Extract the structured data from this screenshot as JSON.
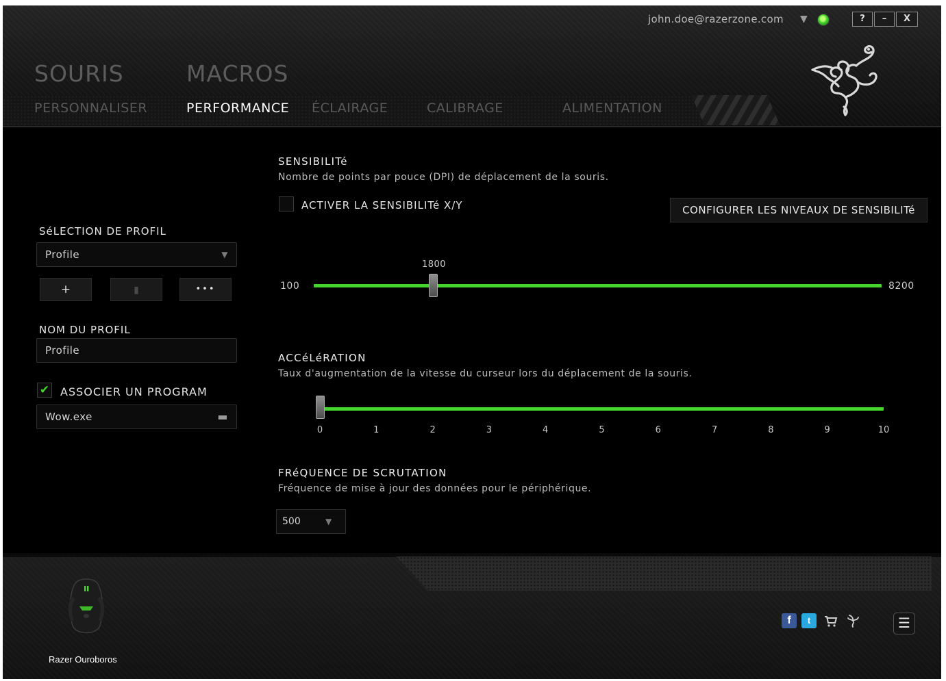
{
  "header": {
    "account_email": "john.doe@razerzone.com",
    "account_menu_icon": "triangle-down-icon",
    "status_icon": "online-dot-icon",
    "window_buttons": {
      "help": "?",
      "minimize": "–",
      "close": "X"
    },
    "main_tabs": [
      {
        "label": "SOURIS",
        "active": false
      },
      {
        "label": "MACROS",
        "active": false
      }
    ],
    "sub_tabs": [
      {
        "label": "PERSONNALISER",
        "active": false
      },
      {
        "label": "PERFORMANCE",
        "active": true
      },
      {
        "label": "ÉCLAIRAGE",
        "active": false
      },
      {
        "label": "CALIBRAGE",
        "active": false
      },
      {
        "label": "ALIMENTATION",
        "active": false
      }
    ],
    "logo": "razer-snake-logo"
  },
  "profile": {
    "selection_label": "SéLECTION DE PROFIL",
    "selected_profile": "Profile",
    "add_button": "+",
    "delete_icon": "trash-icon",
    "more_button": "•••",
    "name_label": "NOM DU PROFIL",
    "name_value": "Profile",
    "associate_checked": true,
    "associate_label": "ASSOCIER UN PROGRAM",
    "program_value": "Wow.exe",
    "folder_icon": "folder-icon"
  },
  "sensitivity": {
    "title": "SENSIBILITé",
    "description": "Nombre de points par pouce (DPI) de déplacement de la souris.",
    "xy_checked": false,
    "xy_label": "ACTIVER LA SENSIBILITé X/Y",
    "config_button": "CONFIGURER LES NIVEAUX DE SENSIBILITé",
    "min": "100",
    "max": "8200",
    "value": "1800",
    "value_num": 1800,
    "min_num": 100,
    "max_num": 8200
  },
  "acceleration": {
    "title": "ACCéLéRATION",
    "description": "Taux d'augmentation de la vitesse du curseur lors du déplacement de la souris.",
    "value_num": 0,
    "ticks": [
      "0",
      "1",
      "2",
      "3",
      "4",
      "5",
      "6",
      "7",
      "8",
      "9",
      "10"
    ]
  },
  "polling": {
    "title": "FRéQUENCE DE SCRUTATION",
    "description": "Fréquence de mise à jour des données pour le périphérique.",
    "value": "500"
  },
  "footer": {
    "device_name": "Razer Ouroboros",
    "device_image": "mouse-image",
    "social": {
      "facebook": "f",
      "twitter": "t"
    },
    "store_icon": "cart-icon",
    "razer_icon": "razer-icon",
    "menu_icon": "menu-icon"
  },
  "colors": {
    "accent": "#44d62c",
    "background": "#000000",
    "inactive_tab": "#5a5a5a",
    "active_tab": "#ffffff"
  }
}
